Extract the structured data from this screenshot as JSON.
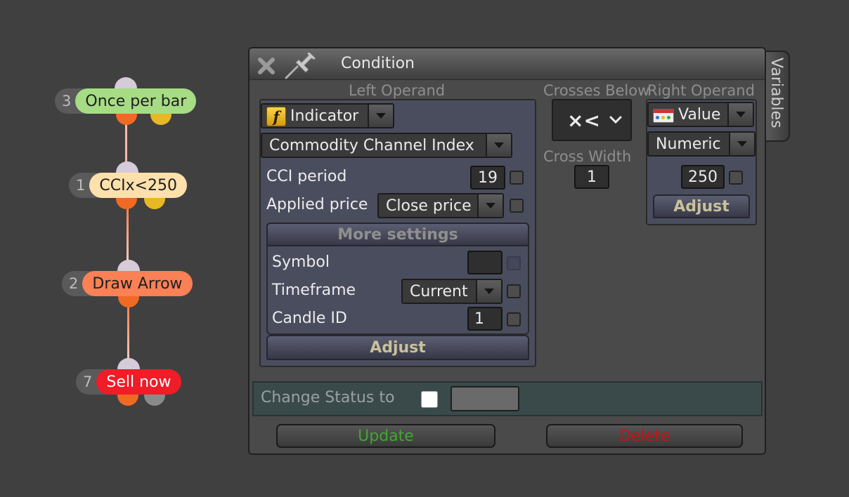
{
  "graph": {
    "nodes": [
      {
        "number": "3",
        "label": "Once per bar",
        "color": "#a6dc84"
      },
      {
        "number": "1",
        "label": "CCIx<250",
        "color": "#fde0ac"
      },
      {
        "number": "2",
        "label": "Draw Arrow",
        "color": "#fa8055"
      },
      {
        "number": "7",
        "label": "Sell now",
        "color": "#f01c28"
      }
    ]
  },
  "dialog": {
    "title": "Condition",
    "side_tab": "Variables",
    "left_operand": {
      "heading": "Left Operand",
      "type": "Indicator",
      "indicator": "Commodity Channel Index",
      "params": [
        {
          "label": "CCI period",
          "value": "19"
        },
        {
          "label": "Applied price",
          "value": "Close price"
        }
      ],
      "more_settings": {
        "label": "More settings",
        "symbol_label": "Symbol",
        "symbol_value": "",
        "timeframe_label": "Timeframe",
        "timeframe_value": "Current",
        "candle_label": "Candle ID",
        "candle_value": "1"
      },
      "adjust_label": "Adjust"
    },
    "operator": {
      "heading": "Crosses Below",
      "symbol": "×<",
      "cross_width_label": "Cross Width",
      "cross_width_value": "1"
    },
    "right_operand": {
      "heading": "Right Operand",
      "type": "Value",
      "subtype": "Numeric",
      "value": "250",
      "adjust_label": "Adjust"
    },
    "status": {
      "label": "Change Status to",
      "value": ""
    },
    "update_label": "Update",
    "delete_label": "Delete"
  },
  "colors": {
    "update": "#3fa82e",
    "delete": "#c41414",
    "status_bg": "#3a4a4a"
  }
}
